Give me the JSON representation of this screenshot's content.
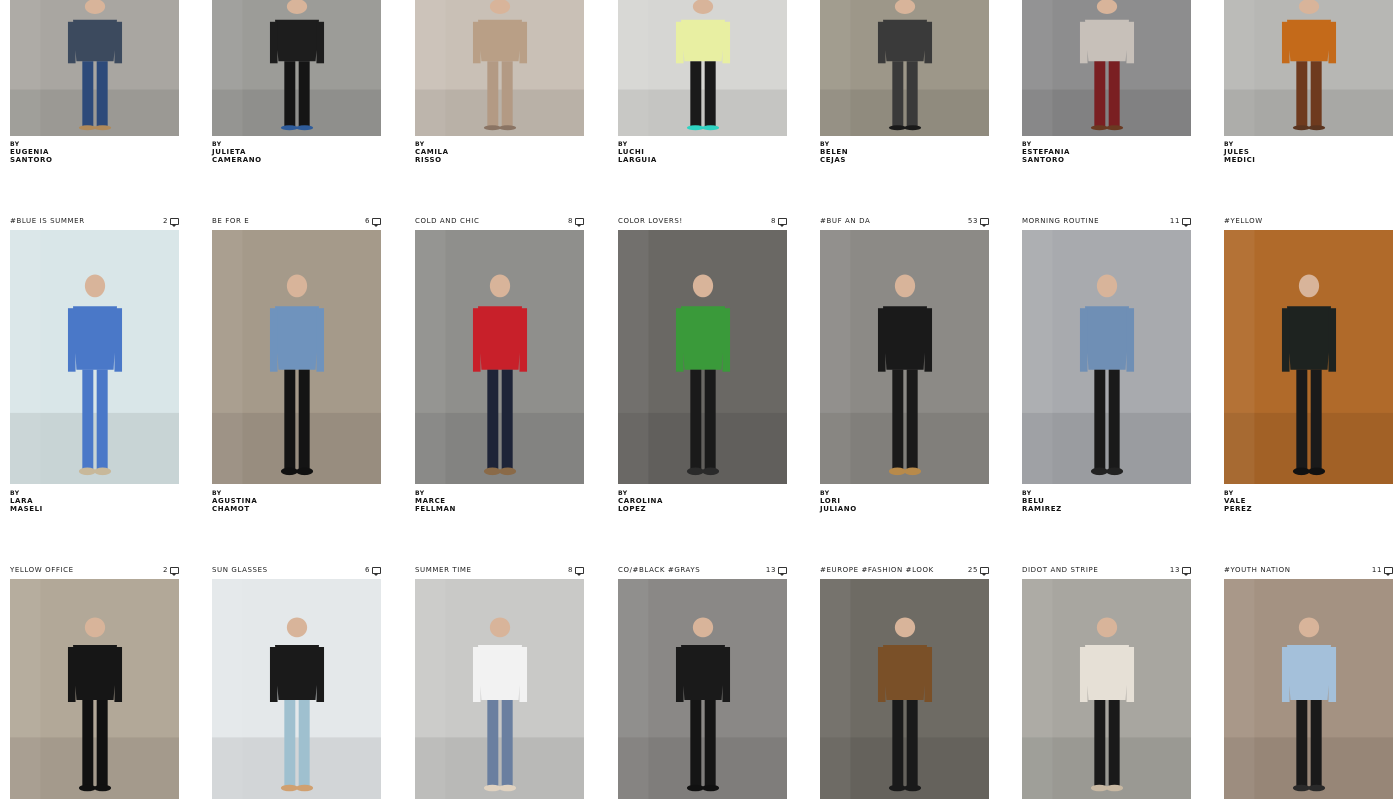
{
  "rows": [
    {
      "posts": [
        {
          "tag": "",
          "count": "",
          "by": "BY",
          "first": "EUGENIA",
          "last": "SANTORO",
          "bg": "#a9a6a1",
          "top": "#3c4a5e",
          "bottom": "#2d4a7a",
          "shoe": "#b08a5a"
        },
        {
          "tag": "",
          "count": "",
          "by": "BY",
          "first": "JULIETA",
          "last": "CAMERANO",
          "bg": "#9c9c98",
          "top": "#1d1d1d",
          "bottom": "#151515",
          "shoe": "#2f5c9a"
        },
        {
          "tag": "",
          "count": "",
          "by": "BY",
          "first": "CAMILA",
          "last": "RISSO",
          "bg": "#c9c0b6",
          "top": "#b99f86",
          "bottom": "#b39a84",
          "shoe": "#8a7464"
        },
        {
          "tag": "",
          "count": "",
          "by": "BY",
          "first": "LUCHI",
          "last": "LARGUIA",
          "bg": "#d6d6d3",
          "top": "#e8efa2",
          "bottom": "#1a1a1a",
          "shoe": "#2fd3c2"
        },
        {
          "tag": "",
          "count": "",
          "by": "BY",
          "first": "BELEN",
          "last": "CEJAS",
          "bg": "#9d9789",
          "top": "#3a3a3a",
          "bottom": "#3a3a3a",
          "shoe": "#1a1a1a"
        },
        {
          "tag": "",
          "count": "",
          "by": "BY",
          "first": "ESTEFANIA",
          "last": "SANTORO",
          "bg": "#8d8d8e",
          "top": "#c7c0b9",
          "bottom": "#7a1f22",
          "shoe": "#6a3a22"
        },
        {
          "tag": "",
          "count": "",
          "by": "BY",
          "first": "JULES",
          "last": "MEDICI",
          "bg": "#b7b7b4",
          "top": "#c46a1a",
          "bottom": "#6e3a1e",
          "shoe": "#5a3520"
        }
      ]
    },
    {
      "posts": [
        {
          "tag": "#BLUE IS SUMMER",
          "count": "2",
          "by": "BY",
          "first": "LARA",
          "last": "MASELI",
          "bg": "#d9e6e8",
          "top": "#4a78c8",
          "bottom": "#4a78c8",
          "shoe": "#c8b89a"
        },
        {
          "tag": "BE FOR E",
          "count": "6",
          "by": "BY",
          "first": "AGUSTINA",
          "last": "CHAMOT",
          "bg": "#a59a8a",
          "top": "#6f93bd",
          "bottom": "#141414",
          "shoe": "#111111"
        },
        {
          "tag": "COLD AND CHIC",
          "count": "8",
          "by": "BY",
          "first": "MARCE",
          "last": "FELLMAN",
          "bg": "#8f8f8c",
          "top": "#c8202a",
          "bottom": "#1e2438",
          "shoe": "#8a6a48"
        },
        {
          "tag": "COLOR LOVERS!",
          "count": "8",
          "by": "BY",
          "first": "CAROLINA",
          "last": "LOPEZ",
          "bg": "#6a6864",
          "top": "#3a9a3a",
          "bottom": "#1a1a1a",
          "shoe": "#2a2a2a"
        },
        {
          "tag": "#BUF AN DA",
          "count": "53",
          "by": "BY",
          "first": "LORI",
          "last": "JULIANO",
          "bg": "#8c8a86",
          "top": "#1a1a1a",
          "bottom": "#1a1a1a",
          "shoe": "#b88a4a"
        },
        {
          "tag": "MORNING ROUTINE",
          "count": "11",
          "by": "BY",
          "first": "BELU",
          "last": "RAMIREZ",
          "bg": "#a8aaae",
          "top": "#6f8fb5",
          "bottom": "#1a1a1a",
          "shoe": "#222222"
        },
        {
          "tag": "#YELLOW",
          "count": "",
          "by": "BY",
          "first": "VALE",
          "last": "PEREZ",
          "bg": "#b06a2a",
          "top": "#1e2320",
          "bottom": "#1a1a1a",
          "shoe": "#111111"
        }
      ]
    },
    {
      "posts": [
        {
          "tag": "YELLOW OFFICE",
          "count": "2",
          "by": "",
          "first": "",
          "last": "",
          "bg": "#b2a898",
          "top": "#161616",
          "bottom": "#111111",
          "shoe": "#111111"
        },
        {
          "tag": "SUN GLASSES",
          "count": "6",
          "by": "",
          "first": "",
          "last": "",
          "bg": "#e4e8ea",
          "top": "#1a1a1a",
          "bottom": "#9fc0cf",
          "shoe": "#d0a070"
        },
        {
          "tag": "SUMMER TIME",
          "count": "8",
          "by": "",
          "first": "",
          "last": "",
          "bg": "#c9c9c7",
          "top": "#f2f2f2",
          "bottom": "#6a7fa0",
          "shoe": "#e0d2c0"
        },
        {
          "tag": "CO/#BLACK #GRAYS",
          "count": "13",
          "by": "",
          "first": "",
          "last": "",
          "bg": "#8a8886",
          "top": "#1a1a1a",
          "bottom": "#151515",
          "shoe": "#111111"
        },
        {
          "tag": "#EUROPE #FASHION #LOOK",
          "count": "25",
          "by": "",
          "first": "",
          "last": "",
          "bg": "#6e6b64",
          "top": "#7a5028",
          "bottom": "#1a1a1a",
          "shoe": "#1a1a1a"
        },
        {
          "tag": "DIDOT AND STRIPE",
          "count": "13",
          "by": "",
          "first": "",
          "last": "",
          "bg": "#a8a6a0",
          "top": "#e6e0d6",
          "bottom": "#1a1a1a",
          "shoe": "#c8b8a2"
        },
        {
          "tag": "#YOUTH NATION",
          "count": "11",
          "by": "",
          "first": "",
          "last": "",
          "bg": "#a49282",
          "top": "#a4c0da",
          "bottom": "#1a1a1a",
          "shoe": "#2a2a2a"
        }
      ]
    }
  ]
}
